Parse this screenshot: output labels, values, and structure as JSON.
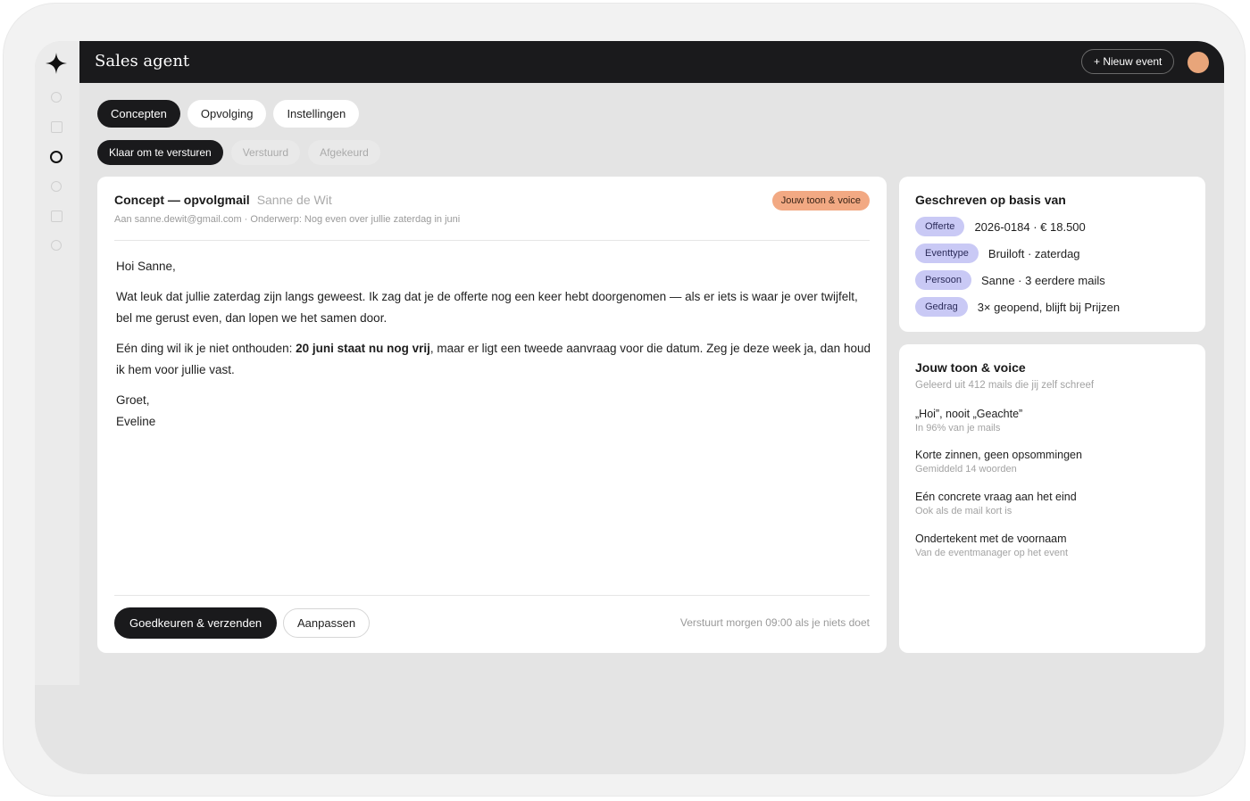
{
  "header": {
    "app_title": "Sales agent",
    "new_event_label": "+ Nieuw event"
  },
  "rail": {
    "logo_icon": "four-point-star-icon",
    "items": [
      "circle-icon",
      "square-icon",
      "circle-icon-active",
      "circle-icon",
      "square-icon",
      "circle-icon"
    ]
  },
  "tabs": [
    {
      "label": "Concepten",
      "active": true
    },
    {
      "label": "Opvolging",
      "active": false
    },
    {
      "label": "Instellingen",
      "active": false
    }
  ],
  "subtabs": [
    {
      "label": "Klaar om te versturen",
      "active": true
    },
    {
      "label": "Verstuurd",
      "active": false
    },
    {
      "label": "Afgekeurd",
      "active": false
    }
  ],
  "mail": {
    "title": "Concept — opvolgmail",
    "recipient_name": "Sanne de Wit",
    "tone_badge": "Jouw toon & voice",
    "meta": "Aan sanne.dewit@gmail.com · Onderwerp: Nog even over jullie zaterdag in juni",
    "greeting": "Hoi Sanne,",
    "paragraph1": "Wat leuk dat jullie zaterdag zijn langs geweest. Ik zag dat je de offerte nog een keer hebt doorgenomen — als er iets is waar je over twijfelt, bel me gerust even, dan lopen we het samen door.",
    "paragraph2_before": "Eén ding wil ik je niet onthouden: ",
    "paragraph2_bold": "20 juni staat nu nog vrij",
    "paragraph2_after": ", maar er ligt een tweede aanvraag voor die datum. Zeg je deze week ja, dan houd ik hem voor jullie vast.",
    "closing": "Groet,",
    "signature": "Eveline",
    "approve_label": "Goedkeuren & verzenden",
    "edit_label": "Aanpassen",
    "send_note": "Verstuurt morgen 09:00 als je niets doet"
  },
  "basis": {
    "title": "Geschreven op basis van",
    "rows": [
      {
        "tag": "Offerte",
        "value": "2026-0184 · € 18.500"
      },
      {
        "tag": "Eventtype",
        "value": "Bruiloft · zaterdag"
      },
      {
        "tag": "Persoon",
        "value": "Sanne · 3 eerdere mails"
      },
      {
        "tag": "Gedrag",
        "value": "3× geopend, blijft bij Prijzen"
      }
    ]
  },
  "voice": {
    "title": "Jouw toon & voice",
    "subtitle": "Geleerd uit 412 mails die jij zelf schreef",
    "traits": [
      {
        "title": "„Hoi”, nooit „Geachte”",
        "detail": "In 96% van je mails"
      },
      {
        "title": "Korte zinnen, geen opsommingen",
        "detail": "Gemiddeld 14 woorden"
      },
      {
        "title": "Eén concrete vraag aan het eind",
        "detail": "Ook als de mail kort is"
      },
      {
        "title": "Ondertekent met de voornaam",
        "detail": "Van de eventmanager op het event"
      }
    ]
  },
  "colors": {
    "dark": "#1a1a1c",
    "accent_peach": "#f2a983",
    "pill_lavender": "#c9c9f5",
    "avatar": "#e8a57a"
  }
}
